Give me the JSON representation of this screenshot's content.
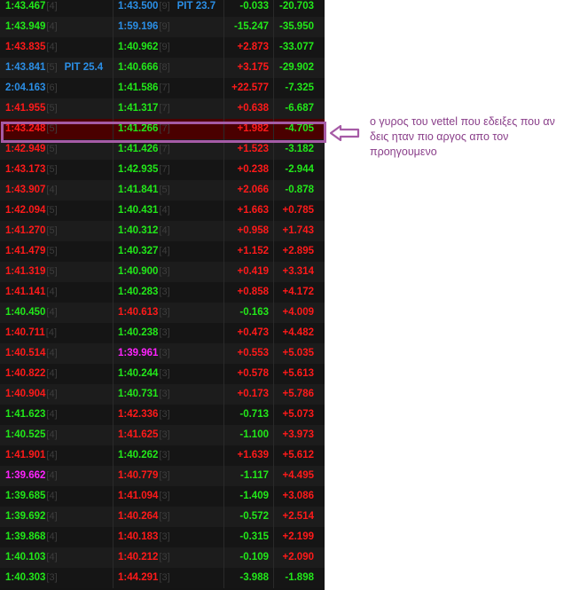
{
  "rows": [
    {
      "t1": "1:43.467",
      "l1": "[4]",
      "c1": "green",
      "p1": "",
      "t2": "1:43.500",
      "l2": "[9]",
      "c2": "blue",
      "p2": "PIT 23.7",
      "g": "-0.033",
      "gc": "green",
      "d": "-20.703",
      "dc": "green"
    },
    {
      "t1": "1:43.949",
      "l1": "[4]",
      "c1": "green",
      "p1": "",
      "t2": "1:59.196",
      "l2": "[9]",
      "c2": "blue",
      "p2": "",
      "g": "-15.247",
      "gc": "green",
      "d": "-35.950",
      "dc": "green"
    },
    {
      "t1": "1:43.835",
      "l1": "[4]",
      "c1": "red",
      "p1": "",
      "t2": "1:40.962",
      "l2": "[9]",
      "c2": "green",
      "p2": "",
      "g": "+2.873",
      "gc": "red",
      "d": "-33.077",
      "dc": "green"
    },
    {
      "t1": "1:43.841",
      "l1": "[5]",
      "c1": "blue",
      "p1": "PIT 25.4",
      "t2": "1:40.666",
      "l2": "[8]",
      "c2": "green",
      "p2": "",
      "g": "+3.175",
      "gc": "red",
      "d": "-29.902",
      "dc": "green"
    },
    {
      "t1": "2:04.163",
      "l1": "[6]",
      "c1": "blue",
      "p1": "",
      "t2": "1:41.586",
      "l2": "[7]",
      "c2": "green",
      "p2": "",
      "g": "+22.577",
      "gc": "red",
      "d": "-7.325",
      "dc": "green"
    },
    {
      "t1": "1:41.955",
      "l1": "[5]",
      "c1": "red",
      "p1": "",
      "t2": "1:41.317",
      "l2": "[7]",
      "c2": "green",
      "p2": "",
      "g": "+0.638",
      "gc": "red",
      "d": "-6.687",
      "dc": "green"
    },
    {
      "t1": "1:43.248",
      "l1": "[5]",
      "c1": "red",
      "p1": "",
      "t2": "1:41.266",
      "l2": "[7]",
      "c2": "green",
      "p2": "",
      "g": "+1.982",
      "gc": "red",
      "d": "-4.705",
      "dc": "green",
      "highlight": true
    },
    {
      "t1": "1:42.949",
      "l1": "[5]",
      "c1": "red",
      "p1": "",
      "t2": "1:41.426",
      "l2": "[7]",
      "c2": "green",
      "p2": "",
      "g": "+1.523",
      "gc": "red",
      "d": "-3.182",
      "dc": "green"
    },
    {
      "t1": "1:43.173",
      "l1": "[5]",
      "c1": "red",
      "p1": "",
      "t2": "1:42.935",
      "l2": "[7]",
      "c2": "green",
      "p2": "",
      "g": "+0.238",
      "gc": "red",
      "d": "-2.944",
      "dc": "green"
    },
    {
      "t1": "1:43.907",
      "l1": "[4]",
      "c1": "red",
      "p1": "",
      "t2": "1:41.841",
      "l2": "[5]",
      "c2": "green",
      "p2": "",
      "g": "+2.066",
      "gc": "red",
      "d": "-0.878",
      "dc": "green"
    },
    {
      "t1": "1:42.094",
      "l1": "[5]",
      "c1": "red",
      "p1": "",
      "t2": "1:40.431",
      "l2": "[4]",
      "c2": "green",
      "p2": "",
      "g": "+1.663",
      "gc": "red",
      "d": "+0.785",
      "dc": "red"
    },
    {
      "t1": "1:41.270",
      "l1": "[5]",
      "c1": "red",
      "p1": "",
      "t2": "1:40.312",
      "l2": "[4]",
      "c2": "green",
      "p2": "",
      "g": "+0.958",
      "gc": "red",
      "d": "+1.743",
      "dc": "red"
    },
    {
      "t1": "1:41.479",
      "l1": "[5]",
      "c1": "red",
      "p1": "",
      "t2": "1:40.327",
      "l2": "[4]",
      "c2": "green",
      "p2": "",
      "g": "+1.152",
      "gc": "red",
      "d": "+2.895",
      "dc": "red"
    },
    {
      "t1": "1:41.319",
      "l1": "[5]",
      "c1": "red",
      "p1": "",
      "t2": "1:40.900",
      "l2": "[3]",
      "c2": "green",
      "p2": "",
      "g": "+0.419",
      "gc": "red",
      "d": "+3.314",
      "dc": "red"
    },
    {
      "t1": "1:41.141",
      "l1": "[4]",
      "c1": "red",
      "p1": "",
      "t2": "1:40.283",
      "l2": "[3]",
      "c2": "green",
      "p2": "",
      "g": "+0.858",
      "gc": "red",
      "d": "+4.172",
      "dc": "red"
    },
    {
      "t1": "1:40.450",
      "l1": "[4]",
      "c1": "green",
      "p1": "",
      "t2": "1:40.613",
      "l2": "[3]",
      "c2": "red",
      "p2": "",
      "g": "-0.163",
      "gc": "green",
      "d": "+4.009",
      "dc": "red"
    },
    {
      "t1": "1:40.711",
      "l1": "[4]",
      "c1": "red",
      "p1": "",
      "t2": "1:40.238",
      "l2": "[3]",
      "c2": "green",
      "p2": "",
      "g": "+0.473",
      "gc": "red",
      "d": "+4.482",
      "dc": "red"
    },
    {
      "t1": "1:40.514",
      "l1": "[4]",
      "c1": "red",
      "p1": "",
      "t2": "1:39.961",
      "l2": "[3]",
      "c2": "purple",
      "p2": "",
      "g": "+0.553",
      "gc": "red",
      "d": "+5.035",
      "dc": "red"
    },
    {
      "t1": "1:40.822",
      "l1": "[4]",
      "c1": "red",
      "p1": "",
      "t2": "1:40.244",
      "l2": "[3]",
      "c2": "green",
      "p2": "",
      "g": "+0.578",
      "gc": "red",
      "d": "+5.613",
      "dc": "red"
    },
    {
      "t1": "1:40.904",
      "l1": "[4]",
      "c1": "red",
      "p1": "",
      "t2": "1:40.731",
      "l2": "[3]",
      "c2": "green",
      "p2": "",
      "g": "+0.173",
      "gc": "red",
      "d": "+5.786",
      "dc": "red"
    },
    {
      "t1": "1:41.623",
      "l1": "[4]",
      "c1": "green",
      "p1": "",
      "t2": "1:42.336",
      "l2": "[3]",
      "c2": "red",
      "p2": "",
      "g": "-0.713",
      "gc": "green",
      "d": "+5.073",
      "dc": "red"
    },
    {
      "t1": "1:40.525",
      "l1": "[4]",
      "c1": "green",
      "p1": "",
      "t2": "1:41.625",
      "l2": "[3]",
      "c2": "red",
      "p2": "",
      "g": "-1.100",
      "gc": "green",
      "d": "+3.973",
      "dc": "red"
    },
    {
      "t1": "1:41.901",
      "l1": "[4]",
      "c1": "red",
      "p1": "",
      "t2": "1:40.262",
      "l2": "[3]",
      "c2": "green",
      "p2": "",
      "g": "+1.639",
      "gc": "red",
      "d": "+5.612",
      "dc": "red"
    },
    {
      "t1": "1:39.662",
      "l1": "[4]",
      "c1": "purple",
      "p1": "",
      "t2": "1:40.779",
      "l2": "[3]",
      "c2": "red",
      "p2": "",
      "g": "-1.117",
      "gc": "green",
      "d": "+4.495",
      "dc": "red"
    },
    {
      "t1": "1:39.685",
      "l1": "[4]",
      "c1": "green",
      "p1": "",
      "t2": "1:41.094",
      "l2": "[3]",
      "c2": "red",
      "p2": "",
      "g": "-1.409",
      "gc": "green",
      "d": "+3.086",
      "dc": "red"
    },
    {
      "t1": "1:39.692",
      "l1": "[4]",
      "c1": "green",
      "p1": "",
      "t2": "1:40.264",
      "l2": "[3]",
      "c2": "red",
      "p2": "",
      "g": "-0.572",
      "gc": "green",
      "d": "+2.514",
      "dc": "red"
    },
    {
      "t1": "1:39.868",
      "l1": "[4]",
      "c1": "green",
      "p1": "",
      "t2": "1:40.183",
      "l2": "[3]",
      "c2": "red",
      "p2": "",
      "g": "-0.315",
      "gc": "green",
      "d": "+2.199",
      "dc": "red"
    },
    {
      "t1": "1:40.103",
      "l1": "[4]",
      "c1": "green",
      "p1": "",
      "t2": "1:40.212",
      "l2": "[3]",
      "c2": "red",
      "p2": "",
      "g": "-0.109",
      "gc": "green",
      "d": "+2.090",
      "dc": "red"
    },
    {
      "t1": "1:40.303",
      "l1": "[3]",
      "c1": "green",
      "p1": "",
      "t2": "1:44.291",
      "l2": "[3]",
      "c2": "red",
      "p2": "",
      "g": "-3.988",
      "gc": "green",
      "d": "-1.898",
      "dc": "green"
    }
  ],
  "annotation": {
    "text": "ο γυρος του vettel που εδειξες που αν δεις ηταν πιο αργος απο τον προηγουμενο",
    "color": "#8a3f8a"
  },
  "colors": {
    "green": "#22e81a",
    "red": "#ff1a1a",
    "blue": "#2b8fe6",
    "purple": "#ff22ff",
    "highlight_border": "#a65ba6"
  }
}
